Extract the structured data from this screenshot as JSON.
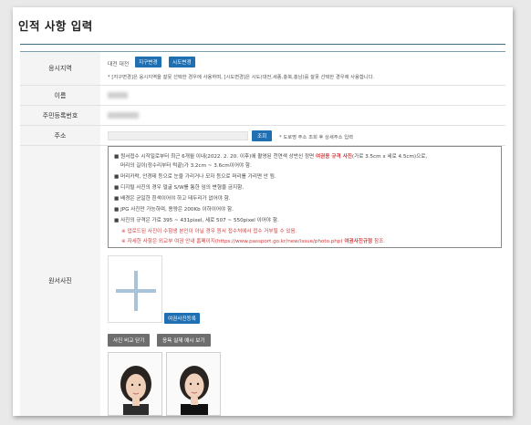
{
  "page_title": "인적 사항 입력",
  "rows": {
    "region": {
      "label": "응시지역",
      "value": "대전 대전",
      "buttons": [
        "지구변경",
        "시도변경"
      ],
      "note": "* [지구변경]은 응시지역을 잘못 선택한 경우에 사용하며, [시도변경]은 시도(대전,세종,충북,충남)를 잘못 선택한 경우에 사용합니다."
    },
    "name": {
      "label": "이름"
    },
    "resident_no": {
      "label": "주민등록번호"
    },
    "address": {
      "label": "주소",
      "search_button": "조회",
      "hint": "* 도로명 주소 조회 후 상세주소 입력"
    },
    "photo": {
      "label": "원서사진"
    }
  },
  "notice": {
    "line1_a": "■ 원서접수 시작일로부터 최근 6개월 이내(2022. 2. 20. 이후)에 촬영된 천연색 상반신 정면",
    "line1_red": "여권용 규격 사진",
    "line1_b": "(가로 3.5cm x 세로 4.5cm)으로,",
    "line1_c": "머리의 길이(정수리부터 턱끝)가 3.2cm ~ 3.6cm이어야 함.",
    "line2": "■ 머리카락, 안경테 등으로 눈을 가리거나 모자 등으로 머리를 가리면 안 됨.",
    "line3": "■ 디지털 사진의 경우 얼굴 S/W를 통한 임의 변형을 금지함.",
    "line4": "■ 배경은 균일한 흰색이어야 하고 테두리가 없어야 함.",
    "line5": "■ JPG 사진만 가능하며, 용량은 200Kb 이하이어야 함.",
    "line6": "■ 사진의 규격은 가로 395 ~ 431pixel, 세로 507 ~ 550pixel 이어야 함.",
    "warn1": "※ 업로드된 사진이 수험생 본인이 아닐 경우 원서 접수처에서 접수 거부될 수 있음.",
    "warn2_a": "※ 자세한 사항은 외교부 여권 안내 홈페이지(https://www.passport.go.kr/new/issue/photo.php)",
    "warn2_red": "여권사진규정",
    "warn2_b": "참조."
  },
  "photo_section": {
    "register_button": "여권사진등록",
    "compare_button": "사진 비교 닫기",
    "example_button": "응욕 실제 예시 보기"
  },
  "colors": {
    "accent": "#1f6fb2",
    "rule": "#3a6f7c",
    "warning": "#d23a3a"
  }
}
